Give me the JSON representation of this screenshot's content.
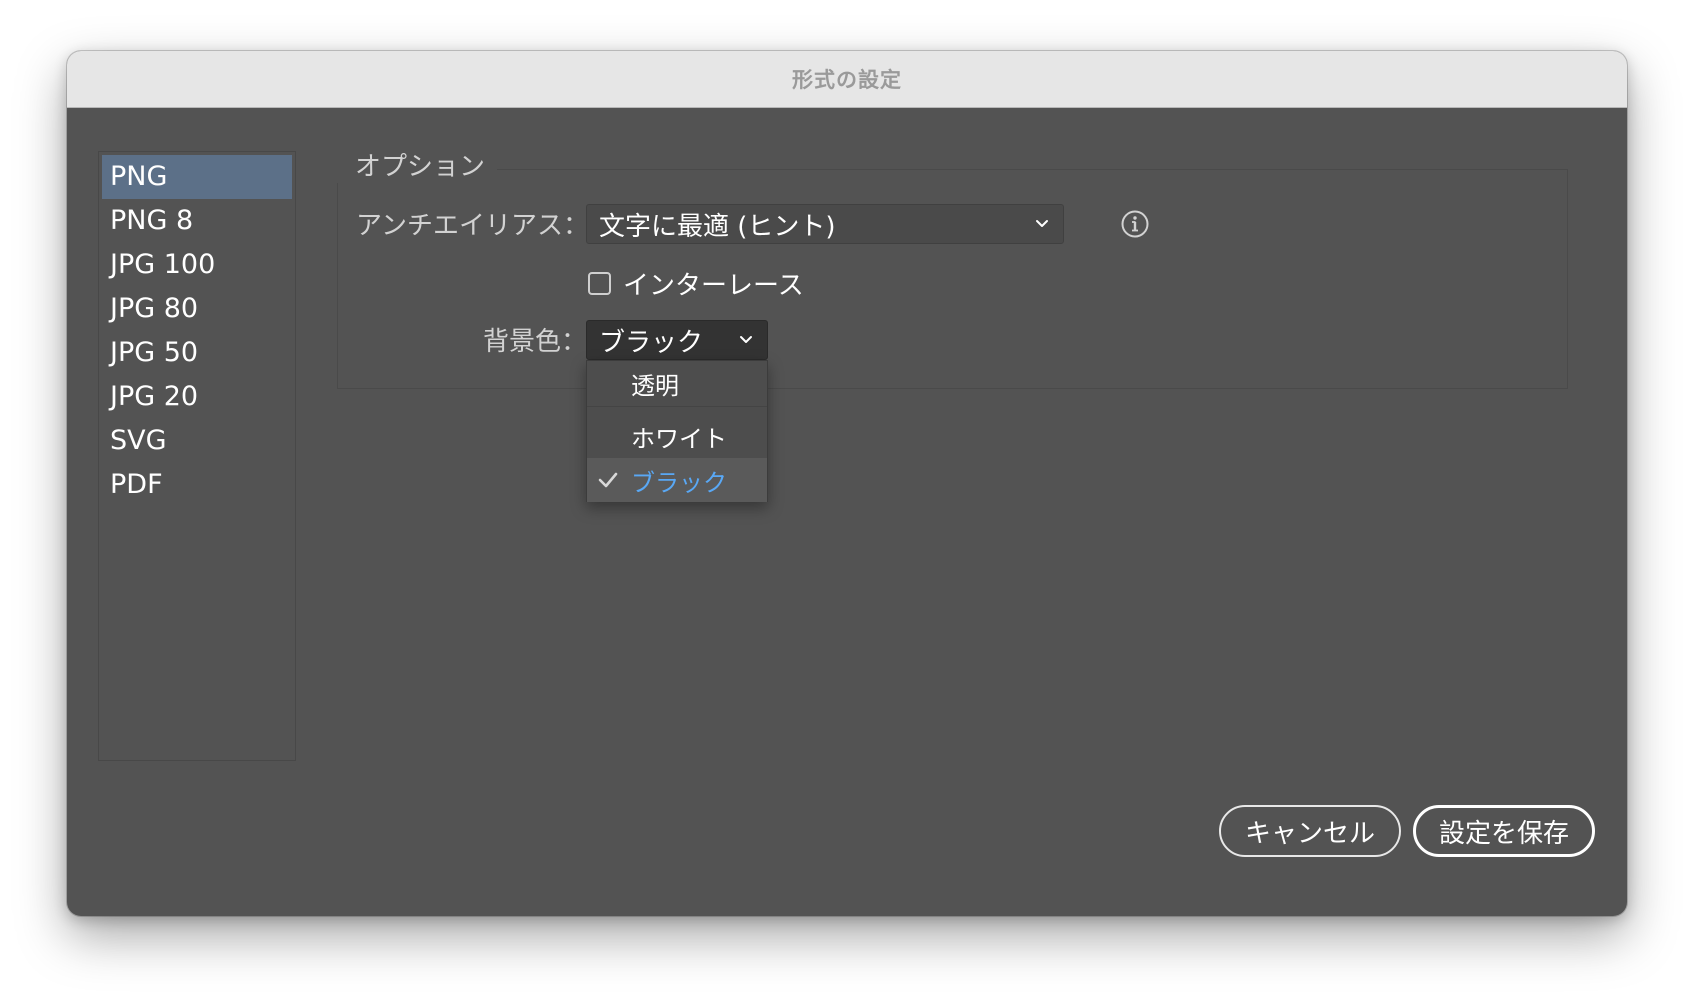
{
  "window": {
    "title": "形式の設定"
  },
  "formats": {
    "items": [
      "PNG",
      "PNG 8",
      "JPG 100",
      "JPG 80",
      "JPG 50",
      "JPG 20",
      "SVG",
      "PDF"
    ],
    "selected": "PNG"
  },
  "options": {
    "legend": "オプション",
    "antialias_label": "アンチエイリアス：",
    "antialias_value": "文字に最適 (ヒント)",
    "interlace_label": "インターレース",
    "interlace_checked": false,
    "bg_label": "背景色：",
    "bg_value": "ブラック"
  },
  "bg_menu": {
    "items": [
      {
        "label": "透明",
        "checked": false
      },
      {
        "label": "ホワイト",
        "checked": false
      },
      {
        "label": "ブラック",
        "checked": true
      }
    ],
    "checked_color": "#59a8f5"
  },
  "buttons": {
    "cancel": "キャンセル",
    "save": "設定を保存"
  },
  "icons": {
    "info": "info-circle-icon",
    "chevron": "chevron-down-icon",
    "check": "checkmark-icon"
  },
  "colors": {
    "panel": "#535353",
    "selection": "#5c7088",
    "titlebar": "#e6e6e6"
  }
}
